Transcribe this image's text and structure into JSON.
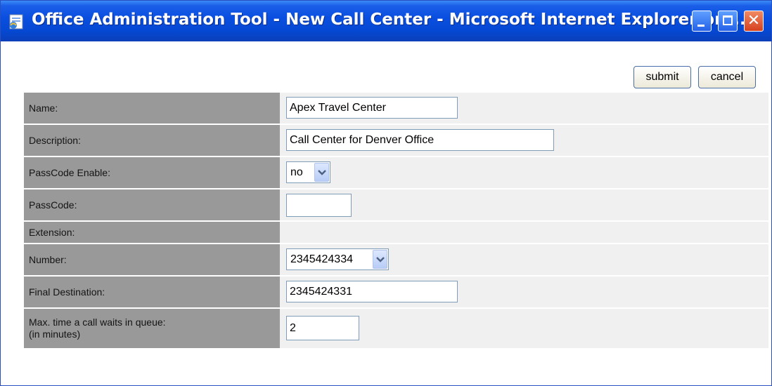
{
  "window": {
    "title": "Office Administration Tool - New Call Center - Microsoft Internet Explorer pro...",
    "icons": {
      "app": "ie-page-icon",
      "minimize": "minimize-icon",
      "maximize": "maximize-icon",
      "close": "close-icon"
    },
    "close_glyph": "✕"
  },
  "actions": {
    "submit_label": "submit",
    "cancel_label": "cancel"
  },
  "form": {
    "name": {
      "label": "Name:",
      "value": "Apex Travel Center"
    },
    "description": {
      "label": "Description:",
      "value": "Call Center for Denver Office"
    },
    "passcode_enable": {
      "label": "PassCode Enable:",
      "selected": "no"
    },
    "passcode": {
      "label": "PassCode:",
      "value": ""
    },
    "extension": {
      "label": "Extension:"
    },
    "number": {
      "label": "Number:",
      "selected": "2345424334"
    },
    "final_destination": {
      "label": "Final Destination:",
      "value": "2345424331"
    },
    "max_wait": {
      "label_line1": "Max. time a call waits in queue:",
      "label_line2": "(in minutes)",
      "value": "2"
    }
  },
  "colors": {
    "titlebar": "#0548d2",
    "label_bg": "#999999",
    "value_bg": "#f0f0f0",
    "input_border": "#7f9db9"
  }
}
